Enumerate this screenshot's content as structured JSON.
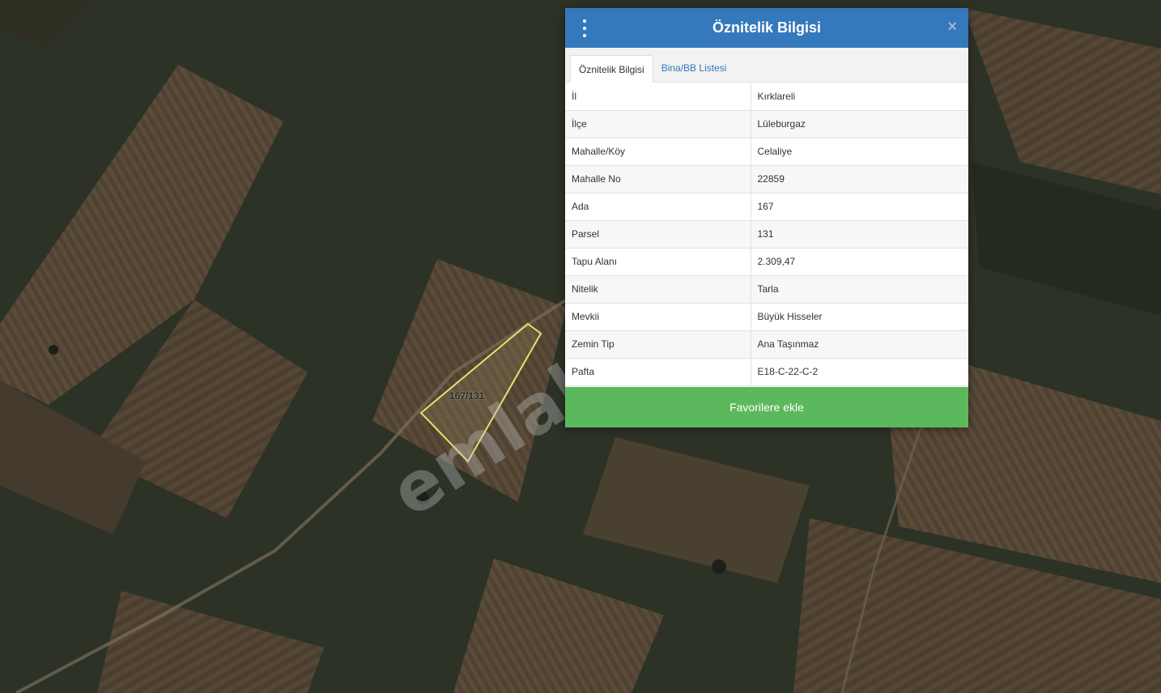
{
  "map": {
    "parcel_label": "167/131",
    "watermark": "emlakjet.com"
  },
  "panel": {
    "title": "Öznitelik Bilgisi",
    "close_symbol": "×",
    "menu_icon": "kebab-menu-icon",
    "tabs": [
      {
        "label": "Öznitelik Bilgisi",
        "active": true
      },
      {
        "label": "Bina/BB Listesi",
        "active": false
      }
    ],
    "rows": [
      {
        "key": "İl",
        "value": "Kırklareli"
      },
      {
        "key": "İlçe",
        "value": "Lüleburgaz"
      },
      {
        "key": "Mahalle/Köy",
        "value": "Celaliye"
      },
      {
        "key": "Mahalle No",
        "value": "22859"
      },
      {
        "key": "Ada",
        "value": "167"
      },
      {
        "key": "Parsel",
        "value": "131"
      },
      {
        "key": "Tapu Alanı",
        "value": "2.309,47"
      },
      {
        "key": "Nitelik",
        "value": "Tarla"
      },
      {
        "key": "Mevkii",
        "value": "Büyük Hisseler"
      },
      {
        "key": "Zemin Tip",
        "value": "Ana Taşınmaz"
      },
      {
        "key": "Pafta",
        "value": "E18-C-22-C-2"
      }
    ],
    "favorite_button": "Favorilere ekle"
  },
  "colors": {
    "header": "#3579bd",
    "favorite": "#5cb85c",
    "parcel_outline": "#e3e36a"
  }
}
